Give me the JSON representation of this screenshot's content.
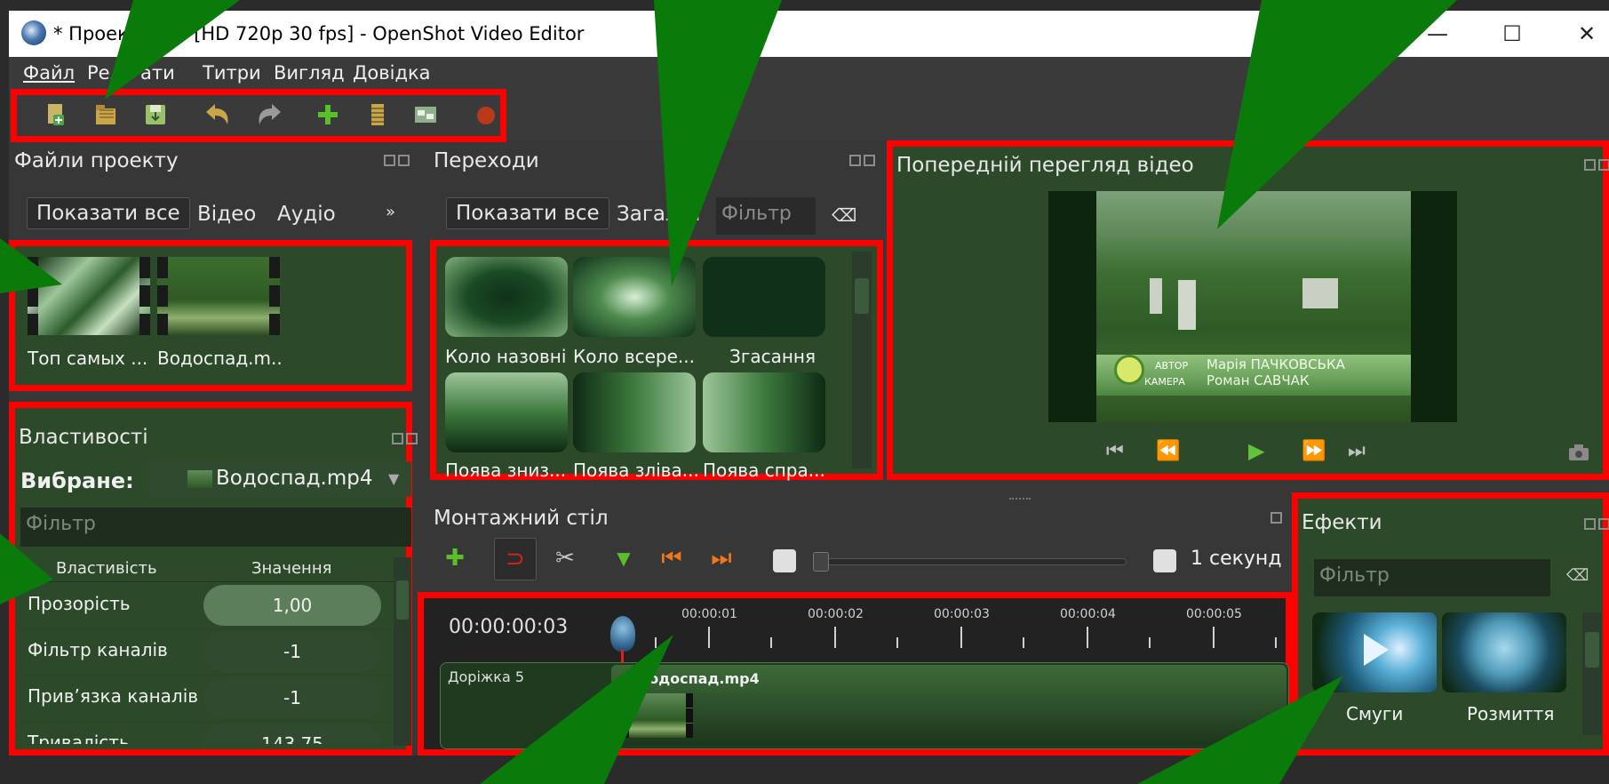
{
  "window": {
    "title": "* Проект без назви [HD 720p 30 fps] - OpenShot Video Editor",
    "title_visible": "* Проек           [HD 720p 30 fps] - OpenShot Video Editor",
    "minimize": "—",
    "maximize": "☐",
    "close": "✕"
  },
  "menu": {
    "items": [
      "Файл",
      "Редагувати",
      "Титри",
      "Вигляд",
      "Довідка"
    ],
    "items_visible": [
      "Файл",
      "Ред",
      "ати",
      "Титри",
      "Вигляд",
      "Довідка"
    ]
  },
  "toolbar": {
    "icons": [
      "new-project-icon",
      "open-project-icon",
      "save-project-icon",
      "undo-icon",
      "redo-icon",
      "import-files-icon",
      "profile-icon",
      "fullscreen-icon",
      "export-video-icon"
    ]
  },
  "project_files": {
    "title": "Файли проекту",
    "tabs": [
      "Показати все",
      "Відео",
      "Аудіо"
    ],
    "more": "»",
    "files": [
      {
        "name": "Топ самых ..."
      },
      {
        "name": "Водоспад.m..."
      }
    ]
  },
  "transitions": {
    "title": "Переходи",
    "tabs": [
      "Показати все",
      "Загал",
      "і"
    ],
    "filter_placeholder": "Фільтр",
    "clear": "⌫",
    "items": [
      {
        "name": "Коло назовні"
      },
      {
        "name": "Коло всере..."
      },
      {
        "name": "Згасання"
      },
      {
        "name": "Поява зниз..."
      },
      {
        "name": "Поява зліва..."
      },
      {
        "name": "Поява спра..."
      }
    ]
  },
  "preview": {
    "title": "Попередній перегляд відео",
    "overlay_line1_a": "АВТОР",
    "overlay_line1_b": "Марія ПАЧКОВСЬКА",
    "overlay_line2_a": "КАМЕРА",
    "overlay_line2_b": "Роман САВЧАК",
    "controls": [
      "⏮",
      "⏪",
      "▶",
      "⏩",
      "⏭"
    ]
  },
  "properties": {
    "title": "Властивості",
    "selected_label": "Вибране:",
    "selected_value": "Водоспад.mp4",
    "filter_placeholder": "Фільтр",
    "col_property": "Властивість",
    "col_value": "Значення",
    "rows": [
      {
        "key": "Прозорість",
        "value": "1,00"
      },
      {
        "key": "Фільтр каналів",
        "value": "-1"
      },
      {
        "key": "Прив’язка каналів",
        "value": "-1"
      },
      {
        "key": "Тривалість",
        "value": "143,75"
      }
    ]
  },
  "timeline": {
    "title": "Монтажний стіл",
    "zoom_label": "1 секунд",
    "timecode": "00:00:00:03",
    "ruler": [
      "00:00:01",
      "00:00:02",
      "00:00:03",
      "00:00:04",
      "00:00:05"
    ],
    "track_name": "Доріжка 5",
    "clip_name": "Водоспад.mp4"
  },
  "effects": {
    "title": "Ефекти",
    "filter_placeholder": "Фільтр",
    "items": [
      {
        "name": "Смуги"
      },
      {
        "name": "Розмиття"
      }
    ]
  },
  "colors": {
    "highlight": "#ff0000",
    "arrow": "#0a7a0a",
    "panel_green": "#2c4a2a"
  }
}
